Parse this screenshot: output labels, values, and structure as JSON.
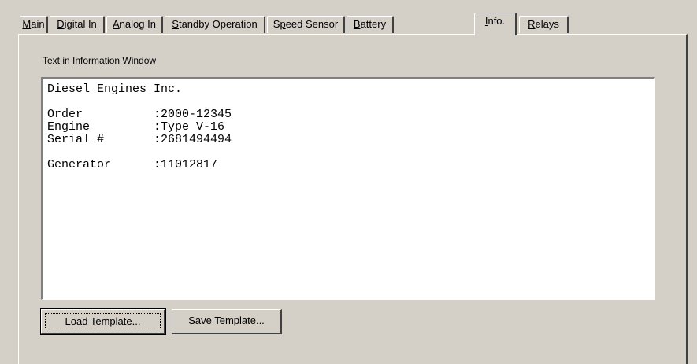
{
  "tabs": [
    {
      "label": "Main",
      "accel_index": 0,
      "active": false
    },
    {
      "label": "Digital In",
      "accel_index": 0,
      "active": false
    },
    {
      "label": "Analog In",
      "accel_index": 0,
      "active": false
    },
    {
      "label": "Standby Operation",
      "accel_index": 0,
      "active": false
    },
    {
      "label": "Speed Sensor",
      "accel_index": 1,
      "active": false
    },
    {
      "label": "Battery",
      "accel_index": 0,
      "active": false
    },
    {
      "label": "Info.",
      "accel_index": 0,
      "active": true
    },
    {
      "label": "Relays",
      "accel_index": 0,
      "active": false
    }
  ],
  "info": {
    "caption": "Text in Information Window",
    "text": "Diesel Engines Inc.\n\nOrder          :2000-12345\nEngine         :Type V-16\nSerial #       :2681494494\n\nGenerator      :11012817"
  },
  "buttons": {
    "load_label": "Load Template...",
    "save_label": "Save Template..."
  }
}
